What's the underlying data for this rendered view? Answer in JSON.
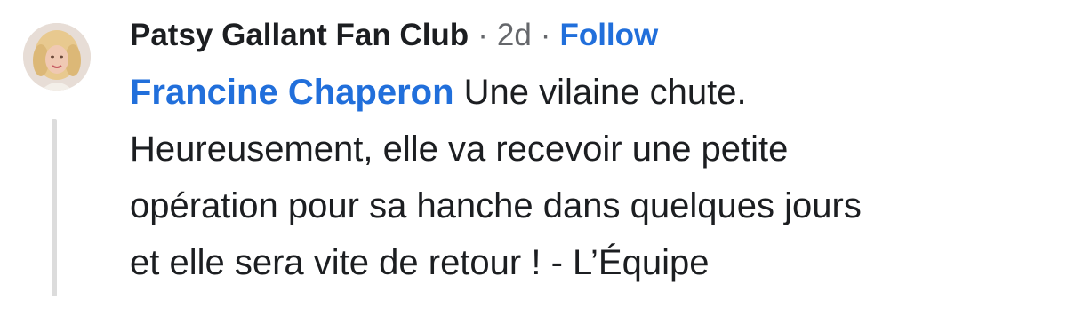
{
  "comment": {
    "author": "Patsy Gallant Fan Club",
    "separator": "·",
    "time": "2d",
    "follow_label": "Follow",
    "mention": "Francine Chaperon",
    "text_line_1": "Une vilaine chute.",
    "text_line_2": "Heureusement, elle va recevoir une petite",
    "text_line_3": "opération pour sa hanche dans quelques jours",
    "text_line_4": "et elle sera vite de retour ! - L’Équipe"
  },
  "colors": {
    "link": "#216fdb",
    "text": "#1c1e21",
    "meta": "#65676b",
    "thread_line": "#dcdcdc"
  },
  "icons": {
    "avatar": "profile-photo-avatar"
  }
}
